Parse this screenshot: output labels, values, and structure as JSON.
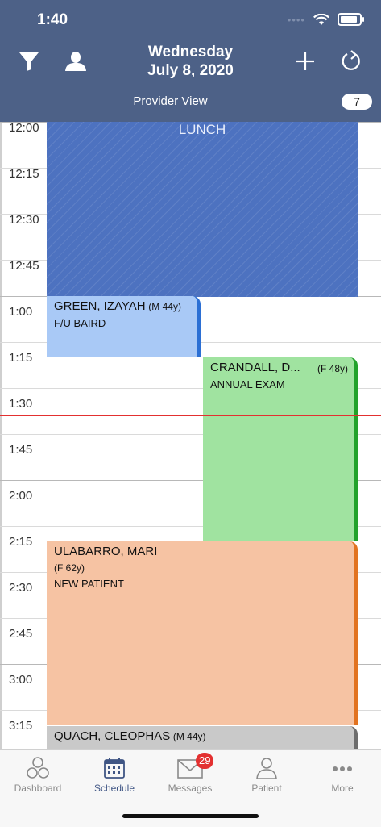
{
  "status": {
    "time": "1:40"
  },
  "header": {
    "day": "Wednesday",
    "date": "July 8,  2020",
    "view_label": "Provider View",
    "count": "7"
  },
  "icons": {
    "filter": "filter-icon",
    "provider": "person-icon",
    "add": "plus-icon",
    "refresh": "refresh-icon"
  },
  "timeslots": [
    "12:00",
    "12:15",
    "12:30",
    "12:45",
    "1:00",
    "1:15",
    "1:30",
    "1:45",
    "2:00",
    "2:15",
    "2:30",
    "2:45",
    "3:00",
    "3:15"
  ],
  "lunch": {
    "label": "LUNCH"
  },
  "appointments": {
    "green": {
      "name": "GREEN, IZAYAH",
      "meta": "(M 44y)",
      "reason": "F/U BAIRD"
    },
    "crandall": {
      "name": "CRANDALL, D...",
      "meta": "(F 48y)",
      "reason": "ANNUAL EXAM"
    },
    "ulabarro": {
      "name": "ULABARRO, MARI",
      "meta": "(F 62y)",
      "reason": "NEW PATIENT"
    },
    "quach": {
      "name": "QUACH, CLEOPHAS",
      "meta": "(M 44y)"
    }
  },
  "colors": {
    "header": "#4d6187",
    "lunch": "#4d72c0",
    "green_appt": "#a9c9f6",
    "crandall_appt": "#a0e3a0",
    "ulabarro_appt": "#f6c3a3",
    "quach_appt": "#c9c9c9",
    "now_line": "#e33030"
  },
  "tabs": {
    "dashboard": "Dashboard",
    "schedule": "Schedule",
    "messages": "Messages",
    "messages_badge": "29",
    "patient": "Patient",
    "more": "More"
  }
}
